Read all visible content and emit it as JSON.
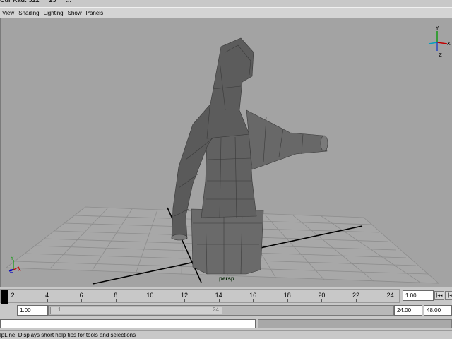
{
  "menubar": {
    "items": [
      "View",
      "Shading",
      "Lighting",
      "Show",
      "Panels"
    ]
  },
  "viewport": {
    "camera_label": "persp",
    "background_color": "#a3a3a3",
    "grid_color": "#8c8c8c",
    "axis_color": "#000000",
    "model_color": "#5e5e5e",
    "view_cube_icon": "view-axes-icon",
    "origin_icon": "xyz-axis-icon"
  },
  "timeslider": {
    "ticks": [
      "2",
      "4",
      "6",
      "8",
      "10",
      "12",
      "14",
      "16",
      "18",
      "20",
      "22",
      "24"
    ],
    "current_time": "1.00"
  },
  "range": {
    "start_time": "1.00",
    "end_time": "24.00",
    "playback_end": "48.00",
    "thumb_start": "1",
    "thumb_end": "24"
  },
  "helpline": {
    "text": "lpLine: Displays short help tips for tools and selections"
  }
}
